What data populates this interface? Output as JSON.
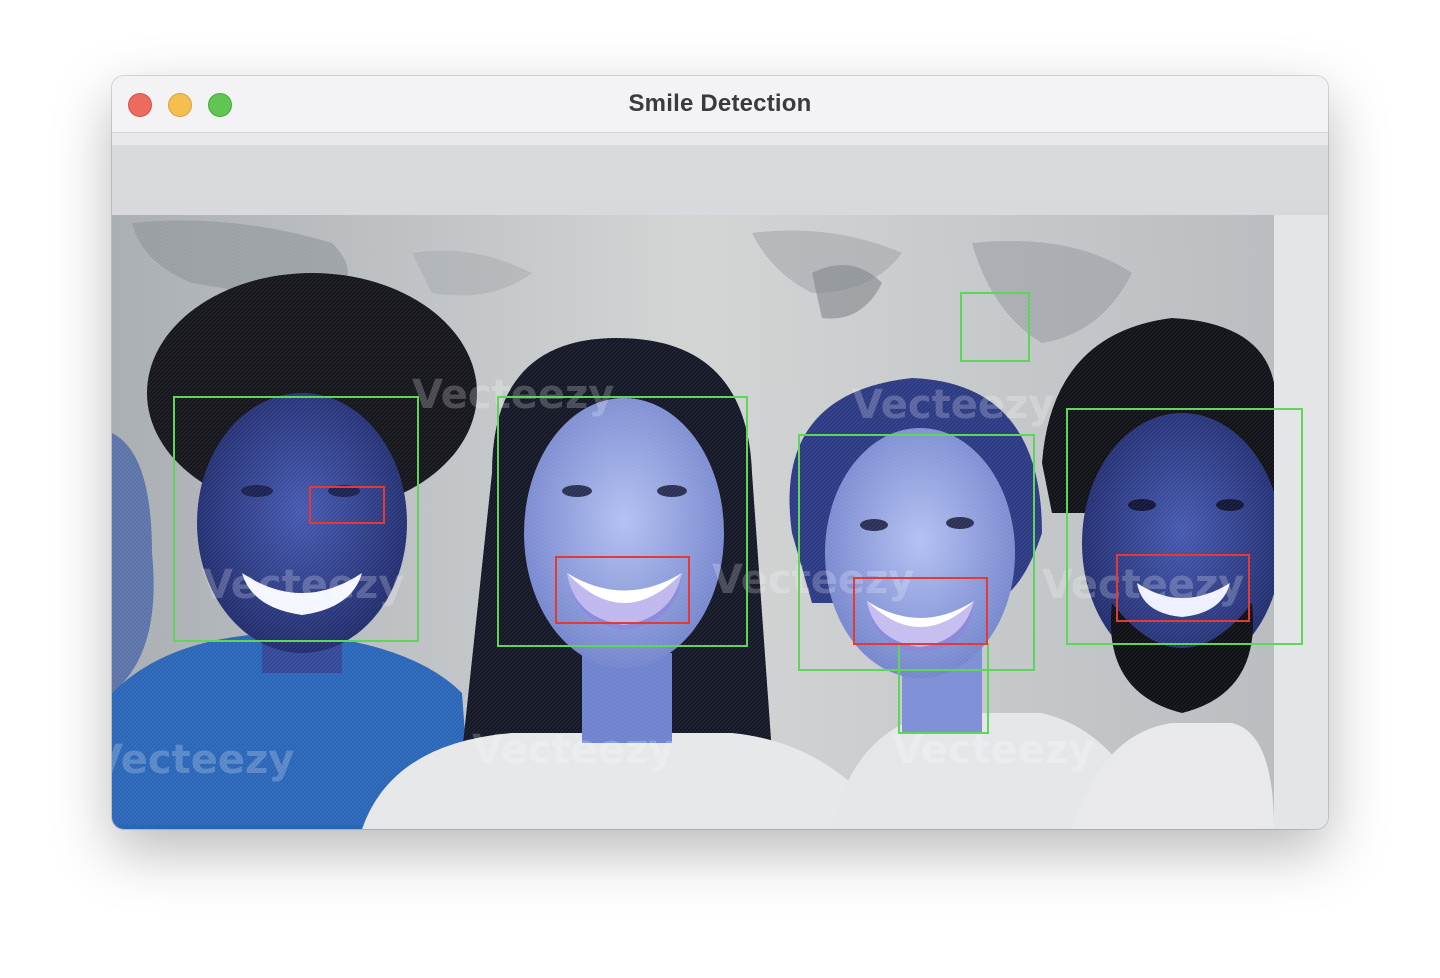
{
  "window": {
    "title": "Smile Detection"
  },
  "video_frame": {
    "watermarks": [
      "Vecteezy",
      "Vecteezy",
      "Vecteezy",
      "Vecteezy",
      "Vecteezy",
      "Vecteezy",
      "Vecteezy",
      "Vecteezy"
    ],
    "colors": {
      "face_box": "#5fd65a",
      "smile_box": "#e23b36"
    }
  }
}
